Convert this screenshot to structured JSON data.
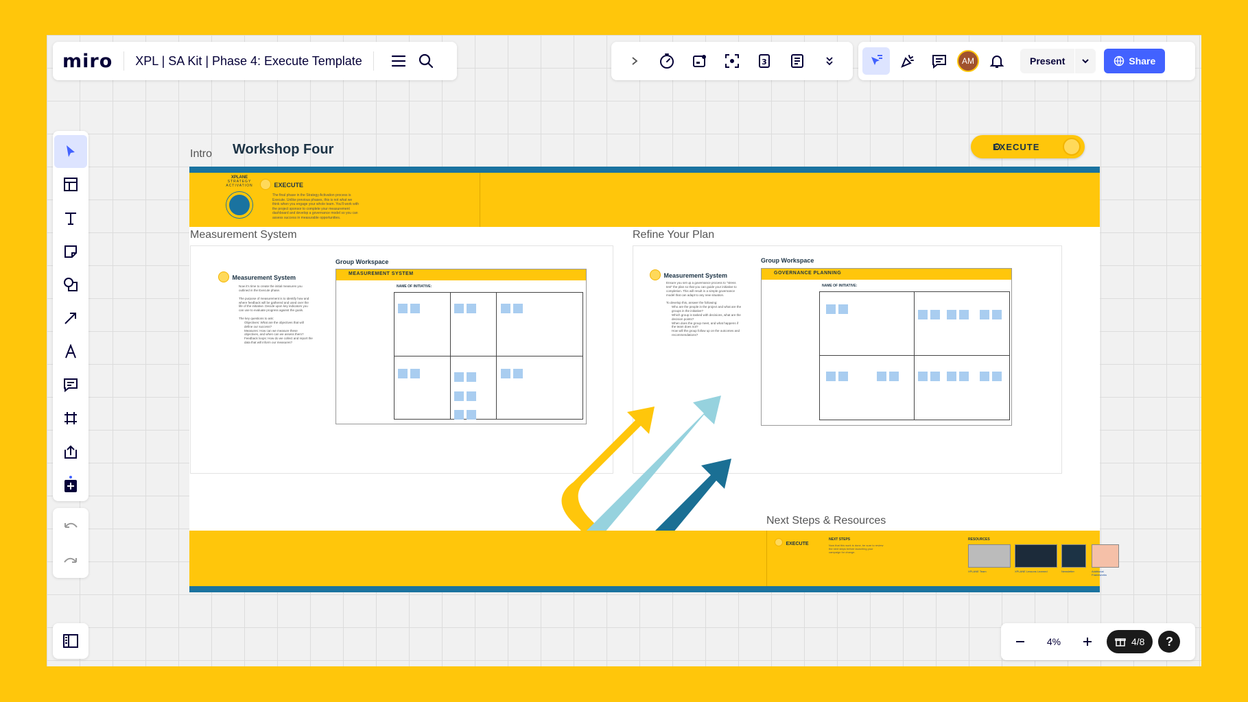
{
  "app": {
    "logo": "miro",
    "board_title": "XPL | SA Kit | Phase 4: Execute Template"
  },
  "toolbar": {
    "present_label": "Present",
    "share_label": "Share",
    "avatar_initials": "AM"
  },
  "zoom": {
    "value": "4%",
    "pages": "4/8"
  },
  "canvas": {
    "intro_label": "Intro",
    "workshop_title": "Workshop Four",
    "execute_pill": "EXECUTE",
    "intro_band": {
      "brand": "XPLANE",
      "brand_sub": "STRATEGY ACTIVATION",
      "heading": "EXECUTE",
      "body": "The final phase in the Strategy Activation process is Execute. Unlike previous phases, this is not what we think when you engage your whole team. You'll work with the project sponsor to complete your measurement dashboard and develop a governance model so you can assess success in measurable opportunities."
    },
    "measurement_label": "Measurement System",
    "refine_label": "Refine Your Plan",
    "next_steps_label": "Next Steps & Resources",
    "left_panel": {
      "heading": "Measurement System",
      "group_workspace": "Group Workspace",
      "worksheet_title": "MEASUREMENT SYSTEM",
      "initiative_label": "NAME OF INITIATIVE:",
      "p1": "Now it's time to create the initial measures you outlined in the Execute phase.",
      "p2": "The purpose of measurement is to identify how and where feedback will be gathered and used over the life of the initiative. Decide upon key indicators you can use to evaluate progress against the goals.",
      "p3": "The key questions to ask:",
      "b1": "Objectives: What are the objectives that will define our success?",
      "b2": "Measures: How can we measure these objectives, and when can we assess them?",
      "b3": "Feedback loops: How do we collect and report the data that will inform our measures?"
    },
    "right_panel": {
      "heading": "Measurement System",
      "group_workspace": "Group Workspace",
      "worksheet_title": "GOVERNANCE PLANNING",
      "initiative_label": "NAME OF INITIATIVE:",
      "p1": "Ensure you set up a governance process to \"stress test\" the plan so that you can guide your initiative to completion. This will result in a simple governance model that can adapt to any new situation.",
      "p2": "To develop this, answer the following:",
      "b1": "Who are the people in the project and what are the groups in the initiative?",
      "b2": "Which group is tasked with decisions, what are the decision points?",
      "b3": "When does the group meet, and what happens if the team does not?",
      "b4": "How will the group follow up on the outcomes and recommendations?"
    },
    "footer_band": {
      "heading": "EXECUTE",
      "next_steps_title": "NEXT STEPS",
      "next_steps_body": "Now that this work is done, be sure to review the next steps before launching your campaign for change.",
      "resources_title": "RESOURCES",
      "resources": [
        "XPLANE Team",
        "XPLANE Lessons Learned",
        "Newsletter",
        "Additional Frameworks"
      ]
    }
  },
  "colors": {
    "brand_yellow": "#ffc60b",
    "brand_blue": "#1a73a0",
    "accent": "#4262ff",
    "light_blue": "#96d2de",
    "dark_blue": "#1a6f94"
  }
}
